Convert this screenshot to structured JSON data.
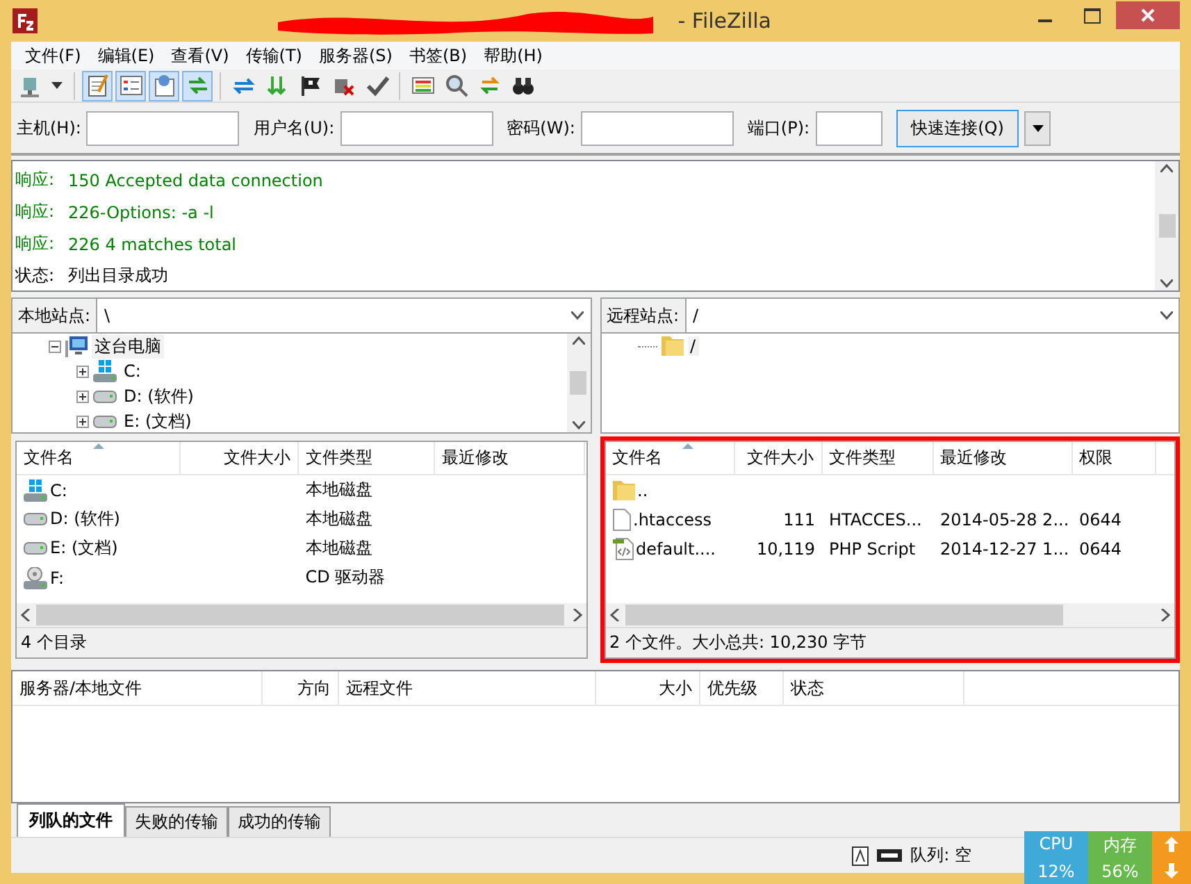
{
  "window": {
    "title": "- FileZilla"
  },
  "menu": [
    "文件(F)",
    "编辑(E)",
    "查看(V)",
    "传输(T)",
    "服务器(S)",
    "书签(B)",
    "帮助(H)"
  ],
  "toolbar_groups": [
    {
      "buttons": [
        {
          "kind": "site",
          "pressed": false
        }
      ]
    },
    {
      "buttons": [
        {
          "kind": "log",
          "pressed": true
        },
        {
          "kind": "tree",
          "pressed": true
        },
        {
          "kind": "remote",
          "pressed": true
        },
        {
          "kind": "queue",
          "pressed": true
        }
      ]
    },
    {
      "buttons": [
        {
          "kind": "refresh",
          "pressed": false
        },
        {
          "kind": "filter",
          "pressed": false
        },
        {
          "kind": "flag",
          "pressed": false
        },
        {
          "kind": "cancel",
          "pressed": false
        },
        {
          "kind": "check",
          "pressed": false
        }
      ]
    },
    {
      "buttons": [
        {
          "kind": "compare",
          "pressed": false
        },
        {
          "kind": "search",
          "pressed": false
        },
        {
          "kind": "sync",
          "pressed": false
        },
        {
          "kind": "find",
          "pressed": false
        }
      ]
    }
  ],
  "quickconnect": {
    "fields": [
      {
        "label": "主机(H):"
      },
      {
        "label": "用户名(U):"
      },
      {
        "label": "密码(W):"
      },
      {
        "label": "端口(P):"
      }
    ],
    "button": "快速连接(Q)"
  },
  "log": [
    {
      "kind": "response",
      "prefix": "响应:",
      "message": "150 Accepted data connection"
    },
    {
      "kind": "response",
      "prefix": "响应:",
      "message": "226-Options: -a -l"
    },
    {
      "kind": "response",
      "prefix": "响应:",
      "message": "226 4 matches total"
    },
    {
      "kind": "status",
      "prefix": "状态:",
      "message": "列出目录成功"
    }
  ],
  "local": {
    "site_label": "本地站点:",
    "path": "\\",
    "tree": [
      {
        "label": "这台电脑",
        "kind": "computer",
        "selected": true,
        "expanded": true,
        "children": [
          {
            "label": "C:",
            "kind": "windrive",
            "selected": false,
            "expanded": false
          },
          {
            "label": "D: (软件)",
            "kind": "drive",
            "selected": false,
            "expanded": false
          },
          {
            "label": "E: (文档)",
            "kind": "drive",
            "selected": false,
            "expanded": false
          }
        ]
      }
    ],
    "columns": [
      {
        "label": "文件名",
        "sorted": true
      },
      {
        "label": "文件大小",
        "sorted": false
      },
      {
        "label": "文件类型",
        "sorted": false
      },
      {
        "label": "最近修改",
        "sorted": false
      }
    ],
    "rows": [
      {
        "kind": "windrive",
        "cells": [
          "C:",
          "",
          "本地磁盘",
          ""
        ]
      },
      {
        "kind": "drive",
        "cells": [
          "D: (软件)",
          "",
          "本地磁盘",
          ""
        ]
      },
      {
        "kind": "drive",
        "cells": [
          "E: (文档)",
          "",
          "本地磁盘",
          ""
        ]
      },
      {
        "kind": "cd",
        "cells": [
          "F:",
          "",
          "CD 驱动器",
          ""
        ]
      }
    ],
    "status": "4 个目录"
  },
  "remote": {
    "site_label": "远程站点:",
    "path": "/",
    "tree": [
      {
        "label": "/",
        "kind": "folder",
        "selected": true
      }
    ],
    "columns": [
      {
        "label": "文件名",
        "sorted": true
      },
      {
        "label": "文件大小",
        "sorted": false
      },
      {
        "label": "文件类型",
        "sorted": false
      },
      {
        "label": "最近修改",
        "sorted": false
      },
      {
        "label": "权限",
        "sorted": false
      }
    ],
    "rows": [
      {
        "kind": "folder",
        "cells": [
          "..",
          "",
          "",
          "",
          ""
        ]
      },
      {
        "kind": "file",
        "cells": [
          ".htaccess",
          "111",
          "HTACCES...",
          "2014-05-28 2...",
          "0644"
        ]
      },
      {
        "kind": "script",
        "cells": [
          "default....",
          "10,119",
          "PHP Script",
          "2014-12-27 1...",
          "0644"
        ]
      }
    ],
    "status": "2 个文件。大小总共: 10,230 字节",
    "highlighted": true
  },
  "queue": {
    "columns": [
      "服务器/本地文件",
      "方向",
      "远程文件",
      "大小",
      "优先级",
      "状态"
    ],
    "tabs": [
      {
        "label": "列队的文件",
        "selected": true
      },
      {
        "label": "失败的传输",
        "selected": false
      },
      {
        "label": "成功的传输",
        "selected": false
      }
    ],
    "status": "队列: 空"
  },
  "monitor": {
    "cpu_label": "CPU",
    "cpu_value": "12%",
    "mem_label": "内存",
    "mem_value": "56%"
  }
}
